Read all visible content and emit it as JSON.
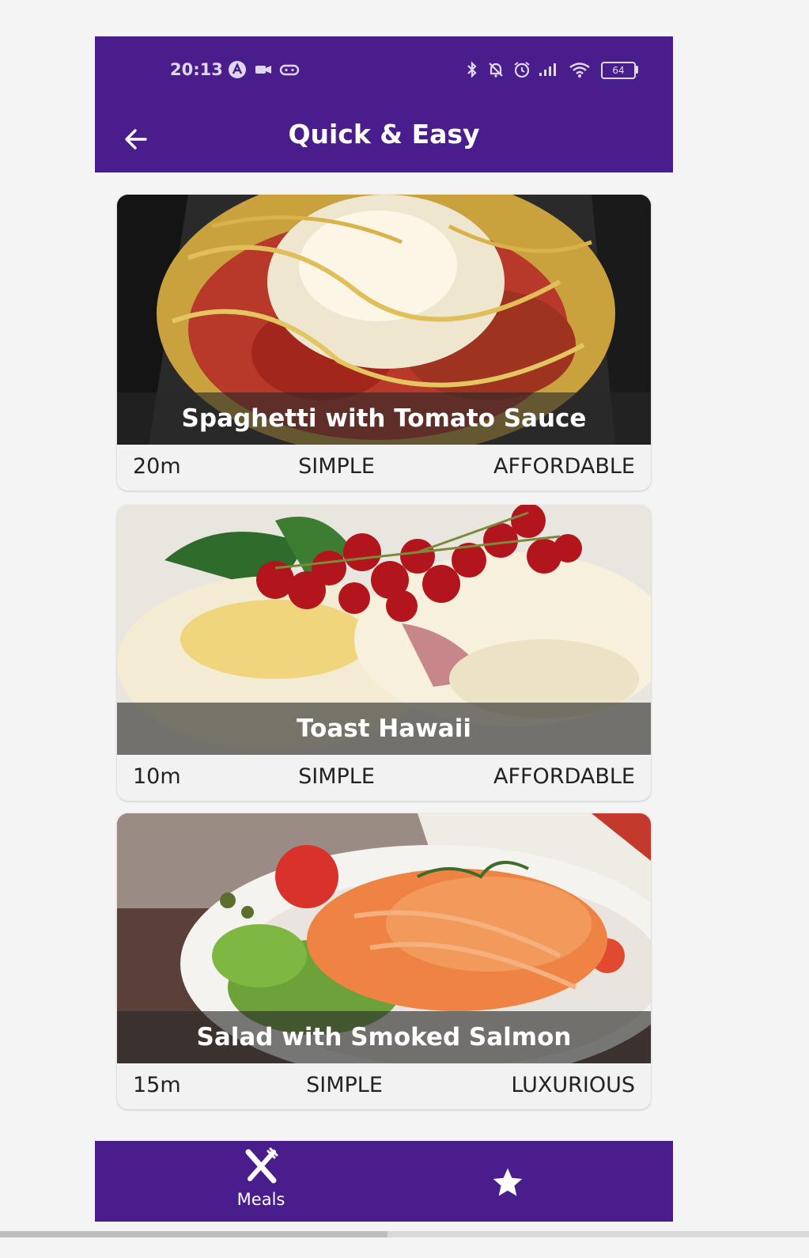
{
  "status_bar": {
    "time": "20:13",
    "battery": "64",
    "icons": [
      "a-badge-icon",
      "camera-icon",
      "gamepad-icon",
      "bluetooth-icon",
      "bell-off-icon",
      "alarm-icon",
      "signal-icon",
      "wifi-icon",
      "battery-icon"
    ]
  },
  "app_bar": {
    "title": "Quick & Easy",
    "back_icon": "arrow-left-icon"
  },
  "meals": [
    {
      "title": "Spaghetti with Tomato Sauce",
      "duration": "20m",
      "complexity": "SIMPLE",
      "affordability": "AFFORDABLE"
    },
    {
      "title": "Toast Hawaii",
      "duration": "10m",
      "complexity": "SIMPLE",
      "affordability": "AFFORDABLE"
    },
    {
      "title": "Salad with Smoked Salmon",
      "duration": "15m",
      "complexity": "SIMPLE",
      "affordability": "LUXURIOUS"
    }
  ],
  "bottom_nav": {
    "meals_label": "Meals",
    "meals_icon": "fork-knife-icon",
    "favorites_icon": "star-icon"
  },
  "colors": {
    "primary": "#4a1d8c",
    "background": "#f4f4f4",
    "caption_overlay": "rgba(40,40,40,0.62)"
  }
}
